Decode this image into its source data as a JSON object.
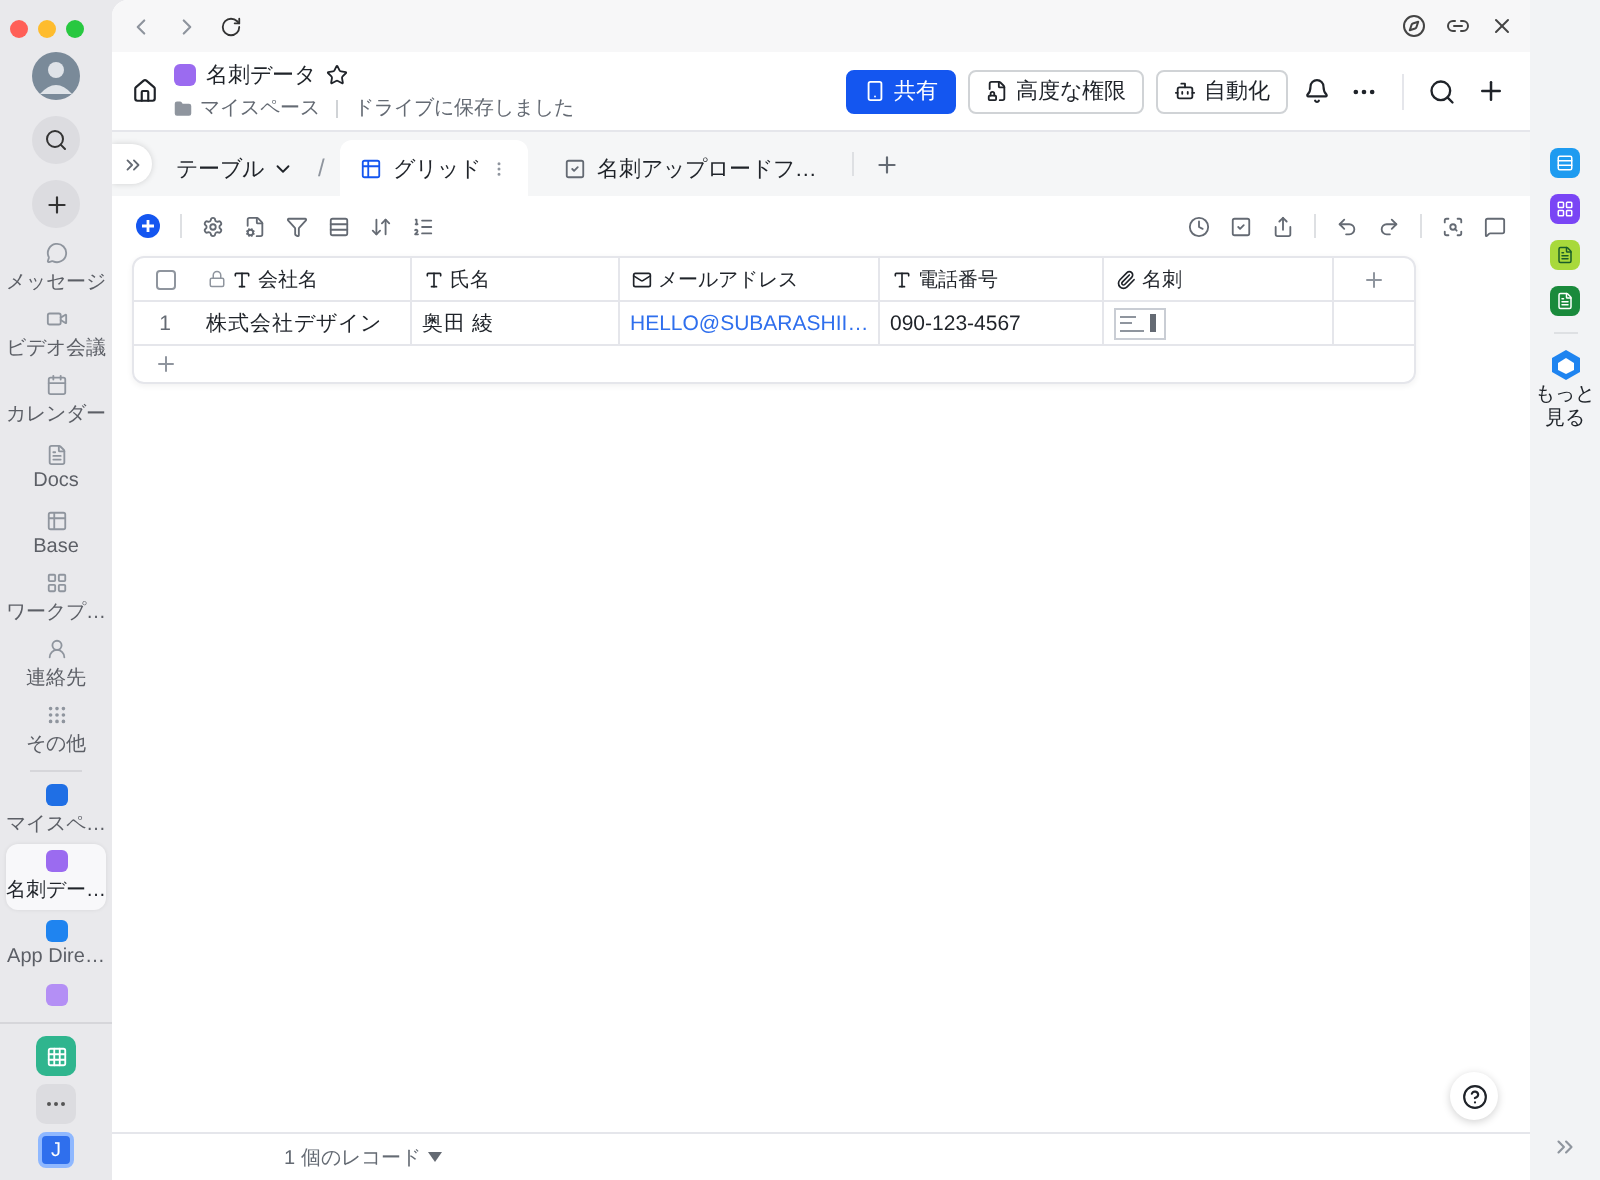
{
  "sidebar": {
    "items": [
      {
        "label": "メッセージ",
        "selected": false
      },
      {
        "label": "ビデオ会議",
        "selected": false
      },
      {
        "label": "カレンダー",
        "selected": false
      },
      {
        "label": "Docs",
        "selected": false
      },
      {
        "label": "Base",
        "selected": false
      },
      {
        "label": "ワークプ…",
        "selected": false
      },
      {
        "label": "連絡先",
        "selected": false
      },
      {
        "label": "その他",
        "selected": false
      }
    ],
    "pinned": [
      {
        "label": "マイスペ…",
        "selected": false
      },
      {
        "label": "名刺デー…",
        "selected": true
      },
      {
        "label": "App Dire…",
        "selected": false
      }
    ],
    "user_initial": "J"
  },
  "header": {
    "title": "名刺データ",
    "location": "マイスペース",
    "save_status": "ドライブに保存しました",
    "buttons": [
      {
        "label": "共有",
        "kind": "primary"
      },
      {
        "label": "高度な権限",
        "kind": "secondary"
      },
      {
        "label": "自動化",
        "kind": "secondary"
      }
    ]
  },
  "tabs": {
    "table_selector": "テーブル",
    "separator": "/",
    "views": [
      {
        "label": "グリッド",
        "selected": true
      },
      {
        "label": "名刺アップロードフ…",
        "selected": false
      }
    ]
  },
  "table": {
    "select_all_checked": false,
    "columns": [
      {
        "label": "会社名",
        "kind": "text",
        "locked": true
      },
      {
        "label": "氏名",
        "kind": "text",
        "locked": false
      },
      {
        "label": "メールアドレス",
        "kind": "email",
        "locked": false
      },
      {
        "label": "電話番号",
        "kind": "text",
        "locked": false
      },
      {
        "label": "名刺",
        "kind": "attachment",
        "locked": false
      }
    ],
    "rows": [
      {
        "index": "1",
        "cells": [
          "株式会社デザイン",
          "奥田 綾",
          "HELLO@SUBARASHII…",
          "090-123-4567",
          ""
        ]
      }
    ]
  },
  "footer": {
    "record_count": "1 個のレコード"
  },
  "right_rail": {
    "more_label": "もっと見る"
  }
}
